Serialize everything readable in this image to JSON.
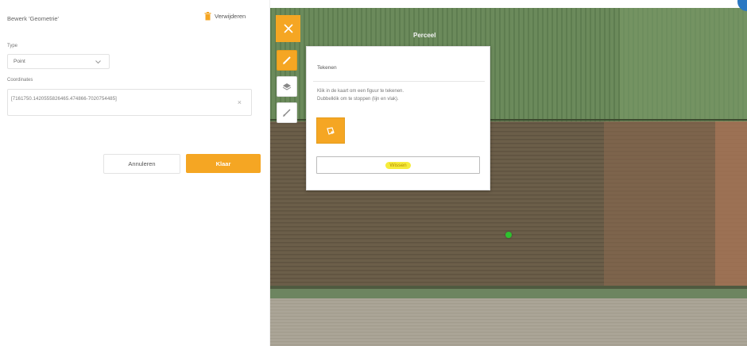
{
  "panel": {
    "title": "Bewerk 'Geometrie'",
    "delete_label": "Verwijderen",
    "type_label": "Type",
    "type_value": "Point",
    "coords_label": "Coordinates",
    "coords_value": "[7161750.1420555826465.474866-7020754485]",
    "clear_symbol": "×",
    "cancel_label": "Annuleren",
    "done_label": "Klaar"
  },
  "map": {
    "label": "Perceel",
    "tools": [
      "close-icon",
      "pencil-icon",
      "layers-icon",
      "edit-icon"
    ],
    "popup": {
      "title": "Tekenen",
      "help_line1": "Klik in de kaart om een figuur te tekenen.",
      "help_line2": "Dubbelklik om te stoppen (lijn en vlak).",
      "polygon_tool_icon": "polygon-draw-icon",
      "clear_label": "Wissen"
    }
  },
  "colors": {
    "accent": "#f5a623",
    "highlight": "#f6ec3b",
    "marker": "#2ec12e",
    "corner": "#2b78c2"
  }
}
